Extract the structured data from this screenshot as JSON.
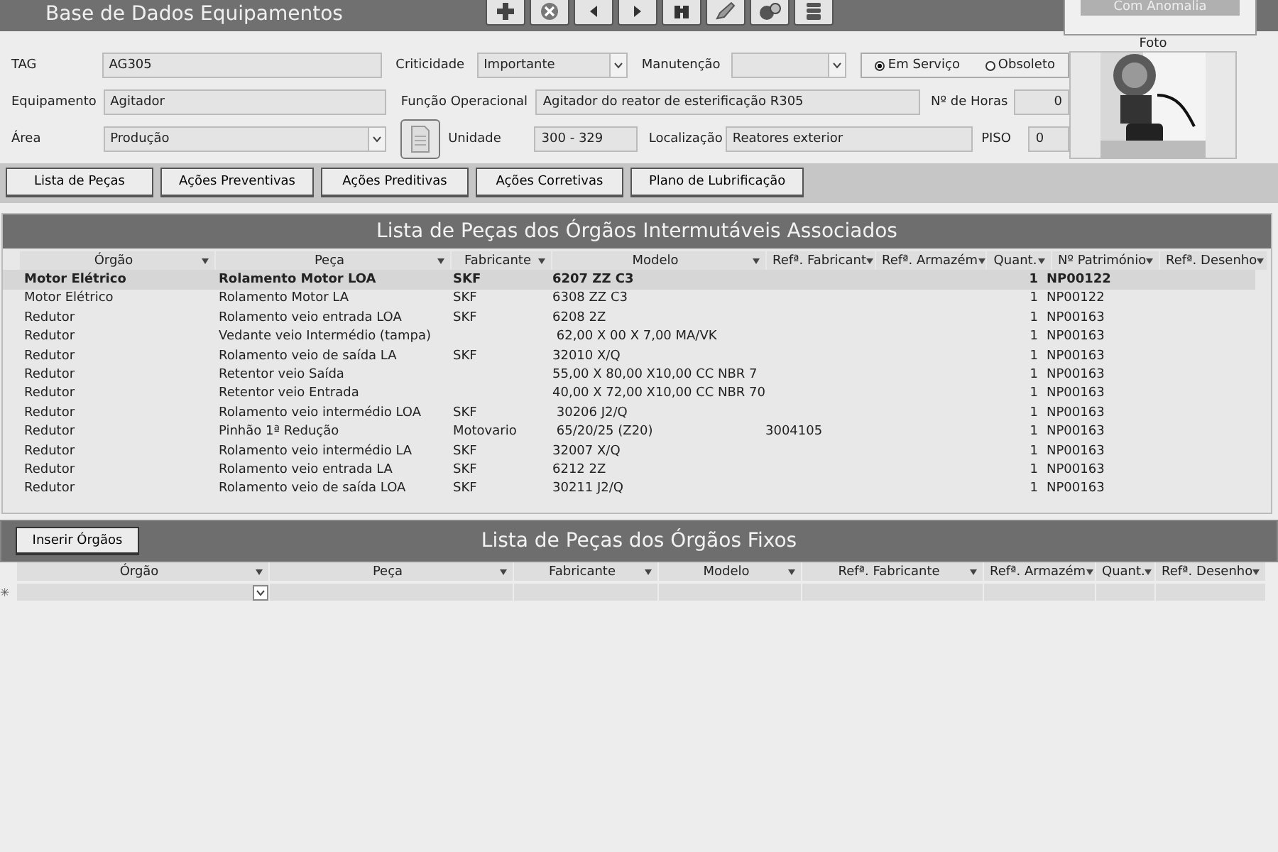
{
  "window": {
    "title": "Base de Dados Equipamentos"
  },
  "status_button": "Com Anomalia",
  "form": {
    "fields": [
      {
        "kind": "label",
        "text": "TAG"
      },
      {
        "kind": "text",
        "value": "AG305"
      },
      {
        "kind": "label",
        "text": "Criticidade"
      },
      {
        "kind": "combo",
        "value": "Importante"
      },
      {
        "kind": "label",
        "text": "Manutenção"
      },
      {
        "kind": "combo"
      },
      {
        "kind": "radio",
        "options": [
          {
            "label": "Em Serviço",
            "selected": true
          },
          {
            "label": "Obsoleto",
            "selected": false
          }
        ]
      },
      {
        "kind": "label",
        "text": "Equipamento"
      },
      {
        "kind": "text",
        "value": "Agitador"
      },
      {
        "kind": "label",
        "text": "Função Operacional"
      },
      {
        "kind": "text",
        "value": "Agitador do reator de esterificação R305"
      },
      {
        "kind": "label",
        "text": "Nº de Horas"
      },
      {
        "kind": "number",
        "value": "0"
      },
      {
        "kind": "label",
        "text": "Área"
      },
      {
        "kind": "combo",
        "value": "Produção"
      },
      {
        "kind": "iconbutton"
      },
      {
        "kind": "label",
        "text": "Unidade"
      },
      {
        "kind": "text",
        "value": "300 - 329"
      },
      {
        "kind": "label",
        "text": "Localização"
      },
      {
        "kind": "text",
        "value": "Reatores exterior"
      },
      {
        "kind": "label",
        "text": "PISO"
      },
      {
        "kind": "text",
        "value": "0"
      }
    ],
    "photo": {
      "label": "Foto",
      "kind": "picture"
    }
  },
  "buttons": [
    "Lista de Peças",
    "Ações Preventivas",
    "Ações Preditivas",
    "Ações Corretivas",
    "Plano de Lubrificação"
  ],
  "interchangeable": {
    "title": "Lista de Peças dos Órgãos Intermutáveis Associados",
    "columns": [
      "Órgão",
      "Peça",
      "Fabricante",
      "Modelo",
      "Refª. Fabricant",
      "Refª. Armazém",
      "Quant.",
      "Nº Património",
      "Refª. Desenho"
    ],
    "rows": [
      {
        "selected": true,
        "cells": [
          "Motor Elétrico",
          "Rolamento Motor LOA",
          "SKF",
          "6207 ZZ C3",
          "",
          "",
          "1",
          "NP00122",
          ""
        ]
      },
      {
        "selected": false,
        "cells": [
          "Motor Elétrico",
          "Rolamento Motor LA",
          "SKF",
          "6308 ZZ C3",
          "",
          "",
          "1",
          "NP00122",
          ""
        ]
      },
      {
        "selected": false,
        "cells": [
          "Redutor",
          "Rolamento veio entrada LOA",
          "SKF",
          "6208 2Z",
          "",
          "",
          "1",
          "NP00163",
          ""
        ]
      },
      {
        "selected": false,
        "cells": [
          "Redutor",
          "Vedante veio Intermédio (tampa)",
          "",
          " 62,00 X 00 X 7,00 MA/VK",
          "",
          "",
          "1",
          "NP00163",
          ""
        ]
      },
      {
        "selected": false,
        "cells": [
          "Redutor",
          "Rolamento veio de saída LA",
          "SKF",
          "32010 X/Q",
          "",
          "",
          "1",
          "NP00163",
          ""
        ]
      },
      {
        "selected": false,
        "cells": [
          "Redutor",
          "Retentor veio Saída",
          "",
          "55,00 X 80,00 X10,00 CC NBR 7",
          "",
          "",
          "1",
          "NP00163",
          ""
        ]
      },
      {
        "selected": false,
        "cells": [
          "Redutor",
          "Retentor veio Entrada",
          "",
          "40,00 X 72,00 X10,00 CC NBR 70",
          "",
          "",
          "1",
          "NP00163",
          ""
        ]
      },
      {
        "selected": false,
        "cells": [
          "Redutor",
          "Rolamento veio intermédio LOA",
          "SKF",
          " 30206 J2/Q",
          "",
          "",
          "1",
          "NP00163",
          ""
        ]
      },
      {
        "selected": false,
        "cells": [
          "Redutor",
          "Pinhão 1ª Redução",
          "Motovario",
          " 65/20/25 (Z20)",
          "3004105",
          "",
          "1",
          "NP00163",
          ""
        ]
      },
      {
        "selected": false,
        "cells": [
          "Redutor",
          "Rolamento veio intermédio LA",
          "SKF",
          "32007 X/Q",
          "",
          "",
          "1",
          "NP00163",
          ""
        ]
      },
      {
        "selected": false,
        "cells": [
          "Redutor",
          "Rolamento veio entrada LA",
          "SKF",
          "6212 2Z",
          "",
          "",
          "1",
          "NP00163",
          ""
        ]
      },
      {
        "selected": false,
        "cells": [
          "Redutor",
          "Rolamento veio de saída LOA",
          "SKF",
          "30211 J2/Q",
          "",
          "",
          "1",
          "NP00163",
          ""
        ]
      }
    ]
  },
  "fixed": {
    "button": "Inserir Órgãos",
    "title": "Lista de Peças dos Órgãos Fixos",
    "columns": [
      "Órgão",
      "Peça",
      "Fabricante",
      "Modelo",
      "Refª. Fabricante",
      "Refª. Armazém",
      "Quant.",
      "Refª. Desenho"
    ],
    "new_row_marker": "✳"
  }
}
